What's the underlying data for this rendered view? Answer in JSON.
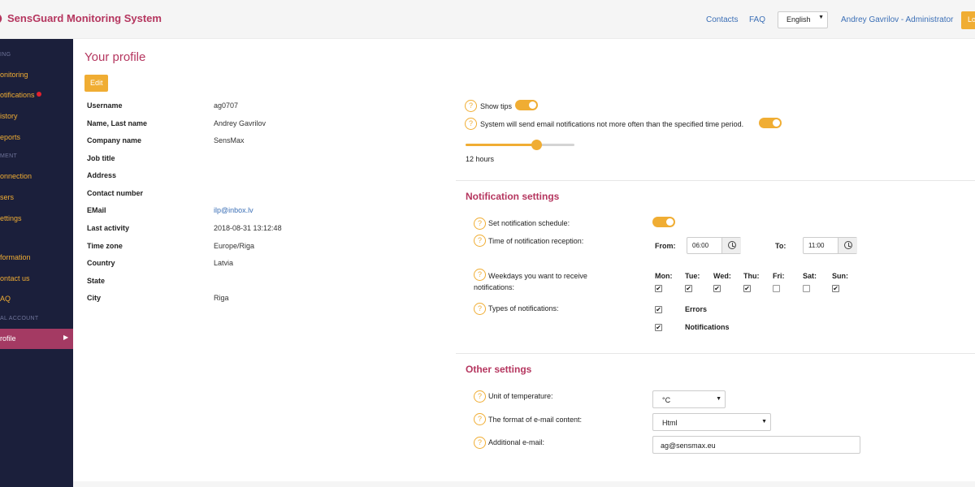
{
  "header": {
    "app_title": "SensGuard Monitoring System",
    "links": {
      "contacts": "Contacts",
      "faq": "FAQ"
    },
    "language": "English",
    "user": "Andrey Gavrilov - Administrator",
    "logout_label": "Lo"
  },
  "sidebar": {
    "section_monitoring": "ING",
    "monitoring": "onitoring",
    "notifications": "otifications",
    "history": "istory",
    "reports": "eports",
    "section_management": "MENT",
    "connection": "onnection",
    "users": "sers",
    "settings": "ettings",
    "information": "formation",
    "contact_us": "ontact us",
    "faq": "AQ",
    "section_account": "AL ACCOUNT",
    "profile": "rofile"
  },
  "profile": {
    "title": "Your profile",
    "edit_label": "Edit",
    "fields": [
      {
        "label": "Username",
        "value": "ag0707"
      },
      {
        "label": "Name, Last name",
        "value": "Andrey Gavrilov"
      },
      {
        "label": "Company name",
        "value": "SensMax"
      },
      {
        "label": "Job title",
        "value": ""
      },
      {
        "label": "Address",
        "value": ""
      },
      {
        "label": "Contact number",
        "value": ""
      },
      {
        "label": "EMail",
        "value": "ilp@inbox.lv"
      },
      {
        "label": "Last activity",
        "value": "2018-08-31 13:12:48"
      },
      {
        "label": "Time zone",
        "value": "Europe/Riga"
      },
      {
        "label": "Country",
        "value": "Latvia"
      },
      {
        "label": "State",
        "value": ""
      },
      {
        "label": "City",
        "value": "Riga"
      }
    ]
  },
  "tips": {
    "show_tips_label": "Show tips",
    "show_tips_on": true,
    "email_period_label": "System will send email notifications not more often than the specified time period.",
    "email_period_on": true,
    "period_label": "12 hours",
    "period_fraction": 0.65
  },
  "notification_settings": {
    "title": "Notification settings",
    "schedule_label": "Set notification schedule:",
    "schedule_on": true,
    "reception_label": "Time of notification reception:",
    "from_label": "From:",
    "from_value": "06:00",
    "to_label": "To:",
    "to_value": "11:00",
    "weekdays_label": "Weekdays you want to receive notifications:",
    "days": [
      {
        "label": "Mon:",
        "checked": true
      },
      {
        "label": "Tue:",
        "checked": true
      },
      {
        "label": "Wed:",
        "checked": true
      },
      {
        "label": "Thu:",
        "checked": true
      },
      {
        "label": "Fri:",
        "checked": false
      },
      {
        "label": "Sat:",
        "checked": false
      },
      {
        "label": "Sun:",
        "checked": true
      }
    ],
    "types_label": "Types of notifications:",
    "types": [
      {
        "label": "Errors",
        "checked": true
      },
      {
        "label": "Notifications",
        "checked": true
      }
    ]
  },
  "other_settings": {
    "title": "Other settings",
    "temperature_label": "Unit of temperature:",
    "temperature_value": "°C",
    "format_label": "The format of e-mail content:",
    "format_value": "Html",
    "additional_email_label": "Additional e-mail:",
    "additional_email_value": "ag@sensmax.eu"
  },
  "colors": {
    "brand": "#b5365f",
    "accent": "#f0ad33",
    "sidebar_bg": "#1b1f3b",
    "link": "#3b6fb6"
  }
}
